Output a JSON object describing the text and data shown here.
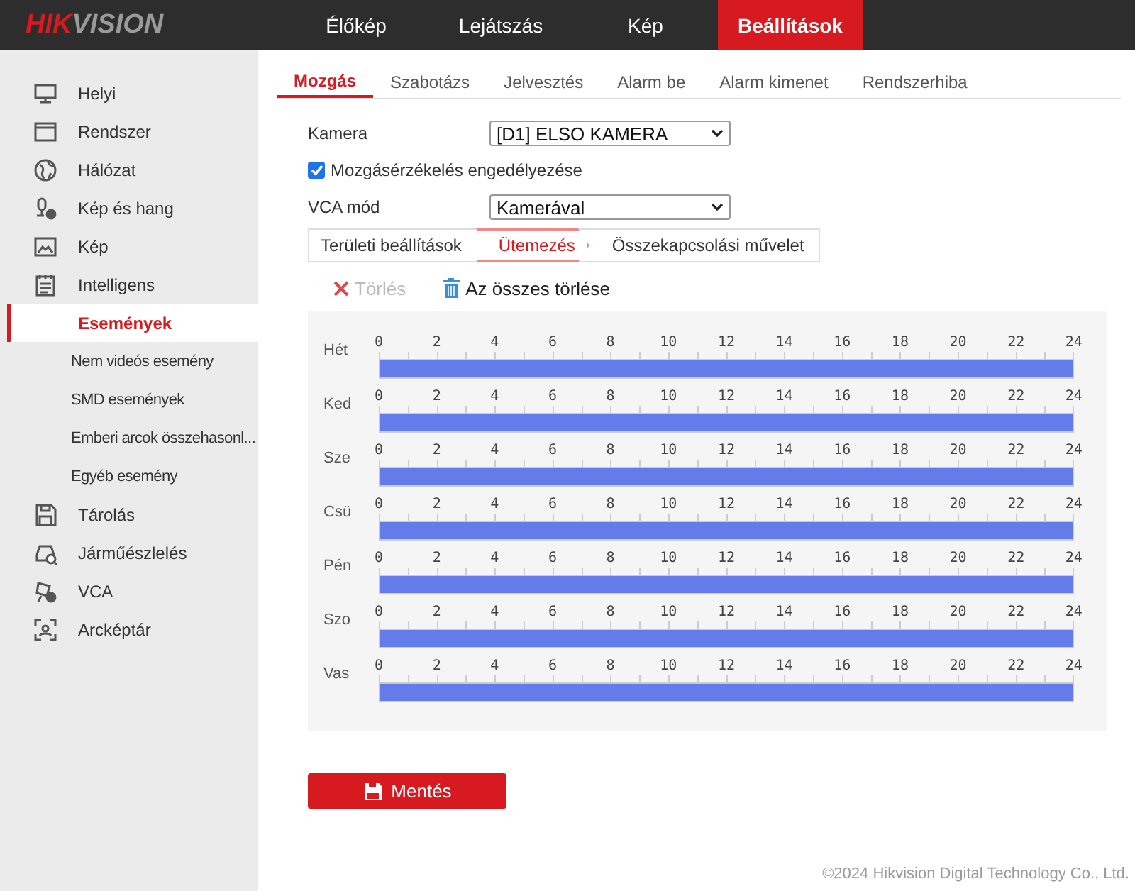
{
  "header": {
    "logo_accent": "HIK",
    "logo_rest": "VISION",
    "nav": [
      {
        "label": "Élőkép",
        "selected": false
      },
      {
        "label": "Lejátszás",
        "selected": false
      },
      {
        "label": "Kép",
        "selected": false
      },
      {
        "label": "Beállítások",
        "selected": true
      }
    ]
  },
  "sidebar": {
    "items": [
      {
        "kind": "menu",
        "label": "Helyi",
        "selected": false
      },
      {
        "kind": "menu",
        "label": "Rendszer",
        "selected": false
      },
      {
        "kind": "menu",
        "label": "Hálózat",
        "selected": false
      },
      {
        "kind": "menu",
        "label": "Kép és hang",
        "selected": false
      },
      {
        "kind": "menu",
        "label": "Kép",
        "selected": false
      },
      {
        "kind": "menu",
        "label": "Intelligens",
        "selected": false
      },
      {
        "kind": "sub",
        "label": "Események",
        "selected": true
      },
      {
        "kind": "sub",
        "label": "Nem videós esemény",
        "selected": false
      },
      {
        "kind": "sub",
        "label": "SMD események",
        "selected": false
      },
      {
        "kind": "sub",
        "label": "Emberi arcok összehasonl...",
        "selected": false
      },
      {
        "kind": "sub",
        "label": "Egyéb esemény",
        "selected": false
      },
      {
        "kind": "menu",
        "label": "Tárolás",
        "selected": false
      },
      {
        "kind": "menu",
        "label": "Járműészlelés",
        "selected": false
      },
      {
        "kind": "menu",
        "label": "VCA",
        "selected": false
      },
      {
        "kind": "menu",
        "label": "Arcképtár",
        "selected": false
      }
    ]
  },
  "tabs": [
    {
      "label": "Mozgás",
      "selected": true
    },
    {
      "label": "Szabotázs",
      "selected": false
    },
    {
      "label": "Jelvesztés",
      "selected": false
    },
    {
      "label": "Alarm be",
      "selected": false
    },
    {
      "label": "Alarm kimenet",
      "selected": false
    },
    {
      "label": "Rendszerhiba",
      "selected": false
    }
  ],
  "form": {
    "camera_label": "Kamera",
    "camera_value": "[D1] ELSO KAMERA",
    "enable_label": "Mozgásérzékelés engedélyezése",
    "enable_checked": true,
    "vca_label": "VCA mód",
    "vca_value": "Kamerával"
  },
  "subtabs": [
    {
      "label": "Területi beállítások",
      "selected": false
    },
    {
      "label": "Ütemezés",
      "selected": true
    },
    {
      "label": "Összekapcsolási művelet",
      "selected": false
    }
  ],
  "toolbar": {
    "delete": {
      "label": "Törlés",
      "disabled": true
    },
    "delete_all": {
      "label": "Az összes törlése",
      "disabled": false
    }
  },
  "schedule": {
    "days": [
      {
        "day": "Hét",
        "level": 1,
        "hours": [
          "0",
          "2",
          "4",
          "6",
          "8",
          "10",
          "12",
          "14",
          "16",
          "18",
          "20",
          "22",
          "24"
        ]
      },
      {
        "day": "Ked",
        "level": 1,
        "hours": [
          "0",
          "2",
          "4",
          "6",
          "8",
          "10",
          "12",
          "14",
          "16",
          "18",
          "20",
          "22",
          "24"
        ]
      },
      {
        "day": "Sze",
        "level": 1,
        "hours": [
          "0",
          "2",
          "4",
          "6",
          "8",
          "10",
          "12",
          "14",
          "16",
          "18",
          "20",
          "22",
          "24"
        ]
      },
      {
        "day": "Csü",
        "level": 1,
        "hours": [
          "0",
          "2",
          "4",
          "6",
          "8",
          "10",
          "12",
          "14",
          "16",
          "18",
          "20",
          "22",
          "24"
        ]
      },
      {
        "day": "Pén",
        "level": 1,
        "hours": [
          "0",
          "2",
          "4",
          "6",
          "8",
          "10",
          "12",
          "14",
          "16",
          "18",
          "20",
          "22",
          "24"
        ]
      },
      {
        "day": "Szo",
        "level": 1,
        "hours": [
          "0",
          "2",
          "4",
          "6",
          "8",
          "10",
          "12",
          "14",
          "16",
          "18",
          "20",
          "22",
          "24"
        ]
      },
      {
        "day": "Vas",
        "level": 1,
        "hours": [
          "0",
          "2",
          "4",
          "6",
          "8",
          "10",
          "12",
          "14",
          "16",
          "18",
          "20",
          "22",
          "24"
        ]
      }
    ]
  },
  "save_button": "Mentés",
  "footer": "©2024 Hikvision Digital Technology Co., Ltd."
}
